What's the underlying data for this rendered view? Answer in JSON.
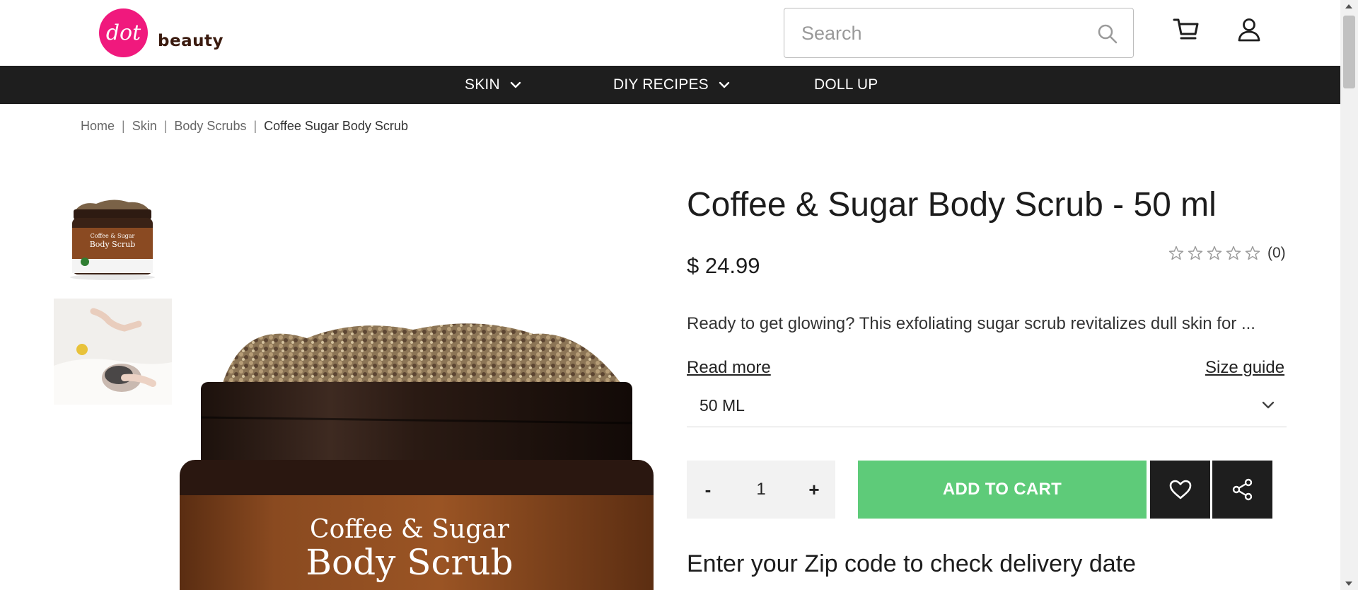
{
  "brand": {
    "logo_mark": "dot",
    "logo_text": "beauty",
    "logo_color": "#f0197d"
  },
  "search": {
    "placeholder": "Search",
    "icon": "search-icon"
  },
  "header_icons": {
    "cart": "cart-icon",
    "account": "user-icon"
  },
  "nav": {
    "items": [
      {
        "label": "SKIN",
        "has_dropdown": true
      },
      {
        "label": "DIY RECIPES",
        "has_dropdown": true
      },
      {
        "label": "DOLL UP",
        "has_dropdown": false
      }
    ]
  },
  "breadcrumb": {
    "items": [
      "Home",
      "Skin",
      "Body Scrubs",
      "Coffee Sugar Body Scrub"
    ]
  },
  "product": {
    "title": "Coffee & Sugar Body Scrub - 50 ml",
    "price": "$ 24.99",
    "rating_stars": 0,
    "rating_max": 5,
    "rating_count": "(0)",
    "description": "Ready to get glowing? This exfoliating sugar scrub revitalizes dull skin for ...",
    "read_more": "Read more",
    "size_guide": "Size guide",
    "size_selected": "50 ML",
    "quantity": "1",
    "qty_minus": "-",
    "qty_plus": "+",
    "add_to_cart": "ADD TO CART",
    "zip_heading": "Enter your Zip code to check delivery date",
    "jar_label_line1": "Coffee & Sugar",
    "jar_label_line2": "Body Scrub",
    "accent_color": "#5ecb79"
  }
}
